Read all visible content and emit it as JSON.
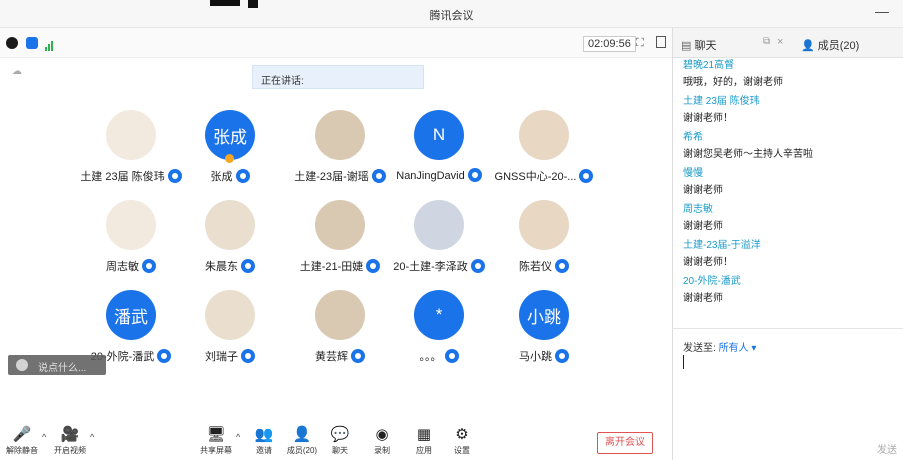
{
  "window": {
    "title": "腾讯会议",
    "minimize": "—"
  },
  "status": {
    "timer": "02:09:56"
  },
  "panel": {
    "chat_tab": "聊天",
    "members_tab": "成员(20)"
  },
  "speaking_label": "正在讲话:",
  "participants": [
    {
      "name": "土建 23届 陈俊玮",
      "avatar_type": "photo"
    },
    {
      "name": "张成",
      "avatar_type": "text",
      "avatar_text": "张成"
    },
    {
      "name": "土建-23届-谢瑶",
      "avatar_type": "photo"
    },
    {
      "name": "NanJingDavid",
      "avatar_type": "text",
      "avatar_text": "N"
    },
    {
      "name": "GNSS中心-20-...",
      "avatar_type": "photo"
    },
    {
      "name": "周志敏",
      "avatar_type": "photo"
    },
    {
      "name": "朱晨东",
      "avatar_type": "photo"
    },
    {
      "name": "土建-21-田婕",
      "avatar_type": "photo"
    },
    {
      "name": "20-土建-李泽政",
      "avatar_type": "photo"
    },
    {
      "name": "陈若仪",
      "avatar_type": "photo"
    },
    {
      "name": "20-外院-潘武",
      "avatar_type": "text",
      "avatar_text": "潘武"
    },
    {
      "name": "刘瑞子",
      "avatar_type": "photo"
    },
    {
      "name": "黄芸辉",
      "avatar_type": "photo"
    },
    {
      "name": "。。。",
      "avatar_type": "text",
      "avatar_text": "*"
    },
    {
      "name": "马小跳",
      "avatar_type": "text",
      "avatar_text": "小跳"
    }
  ],
  "chat_shortcut": "说点什么...",
  "chat": [
    {
      "name": "碧晚21高督",
      "text": "哦哦，好的，谢谢老师"
    },
    {
      "name": "土建 23届 陈俊玮",
      "text": "谢谢老师！"
    },
    {
      "name": "希希",
      "text": "谢谢您吴老师～主持人辛苦啦"
    },
    {
      "name": "慢慢",
      "text": "谢谢老师"
    },
    {
      "name": "周志敏",
      "text": "谢谢老师"
    },
    {
      "name": "土建-23届-于溢洋",
      "text": "谢谢老师！"
    },
    {
      "name": "20-外院-潘武",
      "text": "谢谢老师"
    }
  ],
  "chat_input": {
    "send_to_label": "发送至:",
    "recipient": "所有人 ▾",
    "send_label": "发送"
  },
  "toolbar": {
    "mute": "解除静音",
    "video": "开启视频",
    "share": "共享屏幕",
    "invite": "邀请",
    "members": "成员(20)",
    "chat": "聊天",
    "record": "录制",
    "apps": "应用",
    "settings": "设置",
    "leave": "离开会议"
  },
  "colors": {
    "accent": "#1a73e8",
    "chat_name": "#1a9bc9",
    "leave": "#e05454"
  }
}
